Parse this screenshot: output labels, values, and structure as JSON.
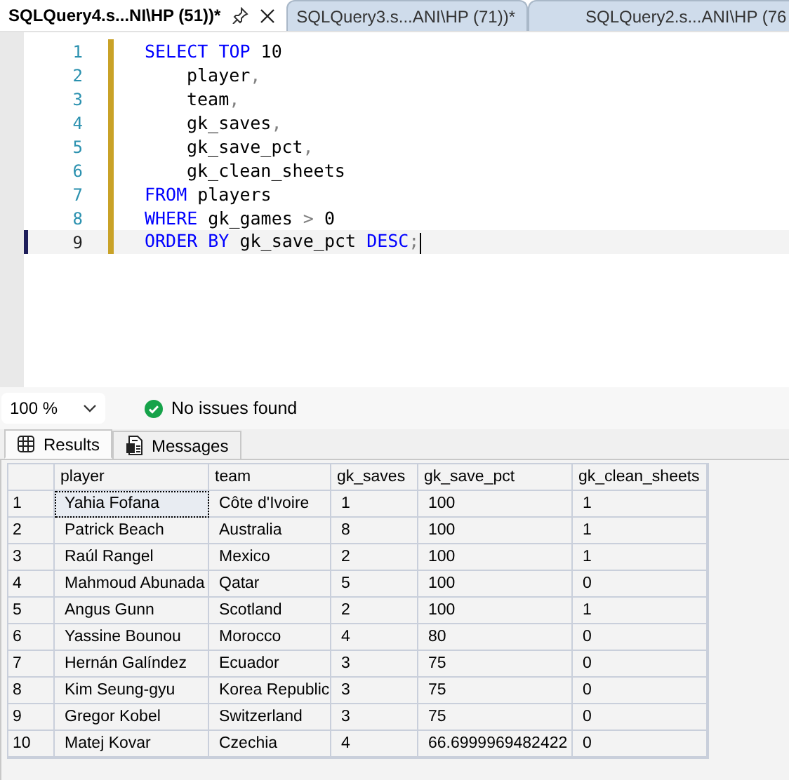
{
  "editor_tabs": [
    {
      "label": "SQLQuery4.s...NI\\HP (51))*",
      "selected": true
    },
    {
      "label": "SQLQuery3.s...ANI\\HP (71))*",
      "selected": false
    },
    {
      "label": "SQLQuery2.s...ANI\\HP (76",
      "selected": false
    }
  ],
  "code_lines": [
    {
      "number": "1",
      "indented": false,
      "current": false,
      "tokens": [
        {
          "text": "SELECT ",
          "kind": "keyword"
        },
        {
          "text": "TOP",
          "kind": "keyword"
        },
        {
          "text": " 10",
          "kind": "plain"
        }
      ]
    },
    {
      "number": "2",
      "indented": true,
      "current": false,
      "tokens": [
        {
          "text": "player",
          "kind": "plain"
        },
        {
          "text": ",",
          "kind": "punct"
        }
      ]
    },
    {
      "number": "3",
      "indented": true,
      "current": false,
      "tokens": [
        {
          "text": "team",
          "kind": "plain"
        },
        {
          "text": ",",
          "kind": "punct"
        }
      ]
    },
    {
      "number": "4",
      "indented": true,
      "current": false,
      "tokens": [
        {
          "text": "gk_saves",
          "kind": "plain"
        },
        {
          "text": ",",
          "kind": "punct"
        }
      ]
    },
    {
      "number": "5",
      "indented": true,
      "current": false,
      "tokens": [
        {
          "text": "gk_save_pct",
          "kind": "plain"
        },
        {
          "text": ",",
          "kind": "punct"
        }
      ]
    },
    {
      "number": "6",
      "indented": true,
      "current": false,
      "tokens": [
        {
          "text": "gk_clean_sheets",
          "kind": "plain"
        }
      ]
    },
    {
      "number": "7",
      "indented": false,
      "current": false,
      "tokens": [
        {
          "text": "FROM",
          "kind": "keyword"
        },
        {
          "text": " players",
          "kind": "plain"
        }
      ]
    },
    {
      "number": "8",
      "indented": false,
      "current": false,
      "tokens": [
        {
          "text": "WHERE",
          "kind": "keyword"
        },
        {
          "text": " gk_games ",
          "kind": "plain"
        },
        {
          "text": ">",
          "kind": "punct"
        },
        {
          "text": " 0",
          "kind": "plain"
        }
      ]
    },
    {
      "number": "9",
      "indented": false,
      "current": true,
      "tokens": [
        {
          "text": "ORDER ",
          "kind": "keyword"
        },
        {
          "text": "BY",
          "kind": "keyword"
        },
        {
          "text": " gk_save_pct ",
          "kind": "plain"
        },
        {
          "text": "DESC",
          "kind": "keyword"
        },
        {
          "text": ";",
          "kind": "punct"
        }
      ]
    }
  ],
  "zoom": {
    "value": "100 %"
  },
  "status": {
    "text": "No issues found"
  },
  "result_tabs": [
    {
      "label": "Results",
      "selected": true
    },
    {
      "label": "Messages",
      "selected": false
    }
  ],
  "table": {
    "columns": [
      "player",
      "team",
      "gk_saves",
      "gk_save_pct",
      "gk_clean_sheets"
    ],
    "rows": [
      {
        "number": "1",
        "cells": [
          {
            "text": "Yahia Fofana",
            "focused": true
          },
          {
            "text": "Côte d'Ivoire",
            "focused": false
          },
          {
            "text": "1",
            "focused": false
          },
          {
            "text": "100",
            "focused": false
          },
          {
            "text": "1",
            "focused": false
          }
        ]
      },
      {
        "number": "2",
        "cells": [
          {
            "text": "Patrick Beach",
            "focused": false
          },
          {
            "text": "Australia",
            "focused": false
          },
          {
            "text": "8",
            "focused": false
          },
          {
            "text": "100",
            "focused": false
          },
          {
            "text": "1",
            "focused": false
          }
        ]
      },
      {
        "number": "3",
        "cells": [
          {
            "text": "Raúl Rangel",
            "focused": false
          },
          {
            "text": "Mexico",
            "focused": false
          },
          {
            "text": "2",
            "focused": false
          },
          {
            "text": "100",
            "focused": false
          },
          {
            "text": "1",
            "focused": false
          }
        ]
      },
      {
        "number": "4",
        "cells": [
          {
            "text": "Mahmoud Abunada",
            "focused": false
          },
          {
            "text": "Qatar",
            "focused": false
          },
          {
            "text": "5",
            "focused": false
          },
          {
            "text": "100",
            "focused": false
          },
          {
            "text": "0",
            "focused": false
          }
        ]
      },
      {
        "number": "5",
        "cells": [
          {
            "text": "Angus Gunn",
            "focused": false
          },
          {
            "text": "Scotland",
            "focused": false
          },
          {
            "text": "2",
            "focused": false
          },
          {
            "text": "100",
            "focused": false
          },
          {
            "text": "1",
            "focused": false
          }
        ]
      },
      {
        "number": "6",
        "cells": [
          {
            "text": "Yassine Bounou",
            "focused": false
          },
          {
            "text": "Morocco",
            "focused": false
          },
          {
            "text": "4",
            "focused": false
          },
          {
            "text": "80",
            "focused": false
          },
          {
            "text": "0",
            "focused": false
          }
        ]
      },
      {
        "number": "7",
        "cells": [
          {
            "text": "Hernán Galíndez",
            "focused": false
          },
          {
            "text": "Ecuador",
            "focused": false
          },
          {
            "text": "3",
            "focused": false
          },
          {
            "text": "75",
            "focused": false
          },
          {
            "text": "0",
            "focused": false
          }
        ]
      },
      {
        "number": "8",
        "cells": [
          {
            "text": "Kim Seung-gyu",
            "focused": false
          },
          {
            "text": "Korea Republic",
            "focused": false
          },
          {
            "text": "3",
            "focused": false
          },
          {
            "text": "75",
            "focused": false
          },
          {
            "text": "0",
            "focused": false
          }
        ]
      },
      {
        "number": "9",
        "cells": [
          {
            "text": "Gregor Kobel",
            "focused": false
          },
          {
            "text": "Switzerland",
            "focused": false
          },
          {
            "text": "3",
            "focused": false
          },
          {
            "text": "75",
            "focused": false
          },
          {
            "text": "0",
            "focused": false
          }
        ]
      },
      {
        "number": "10",
        "cells": [
          {
            "text": "Matej Kovar",
            "focused": false
          },
          {
            "text": "Czechia",
            "focused": false
          },
          {
            "text": "4",
            "focused": false
          },
          {
            "text": "66.6999969482422",
            "focused": false
          },
          {
            "text": "0",
            "focused": false
          }
        ]
      }
    ]
  }
}
